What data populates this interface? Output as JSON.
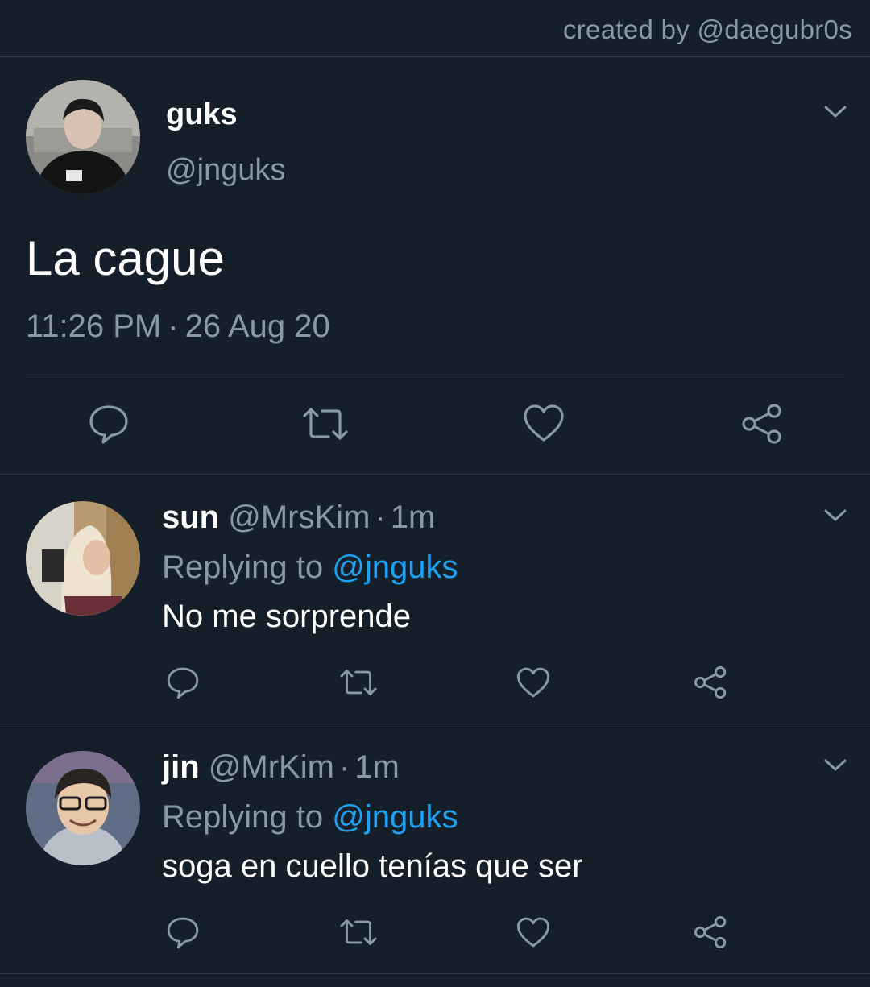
{
  "credit": "created by @daegubr0s",
  "colors": {
    "background": "#151f2a",
    "muted": "#8899a6",
    "link": "#1da1f2",
    "divider": "#2c3844"
  },
  "main_tweet": {
    "name": "guks",
    "handle": "@jnguks",
    "text": "La cague",
    "time": "11:26 PM",
    "separator": "·",
    "date": "26 Aug 20",
    "icons": [
      "reply-icon",
      "retweet-icon",
      "like-icon",
      "share-icon",
      "chevron-down-icon"
    ]
  },
  "replies": [
    {
      "name": "sun",
      "handle": "@MrsKim",
      "separator": "·",
      "time": "1m",
      "replying_label": "Replying to",
      "replying_to": "@jnguks",
      "text": "No me sorprende"
    },
    {
      "name": "jin",
      "handle": "@MrKim",
      "separator": "·",
      "time": "1m",
      "replying_label": "Replying to",
      "replying_to": "@jnguks",
      "text": "soga en cuello tenías que ser"
    }
  ]
}
